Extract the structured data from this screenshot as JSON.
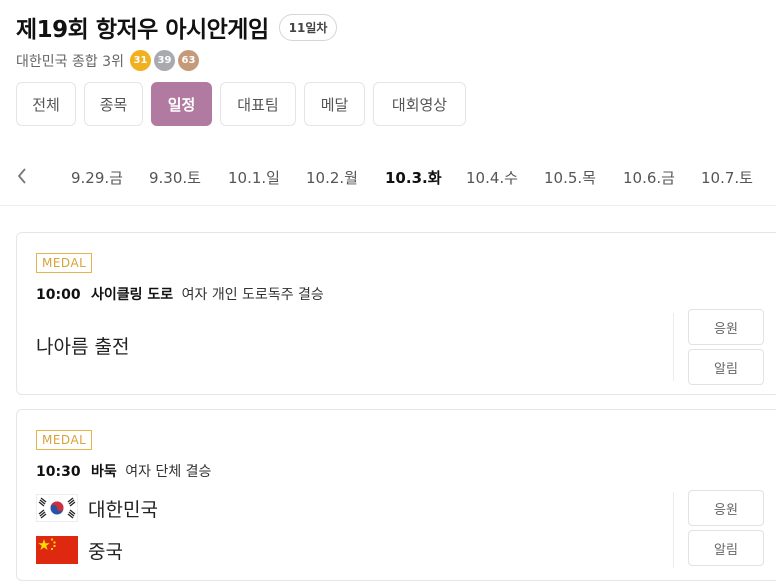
{
  "header": {
    "title": "제19회 항저우 아시안게임",
    "day_badge": "11일차",
    "rank_text": "대한민국 종합 3위",
    "medals": {
      "gold": "31",
      "silver": "39",
      "bronze": "63"
    }
  },
  "tabs": [
    {
      "label": "전체"
    },
    {
      "label": "종목"
    },
    {
      "label": "일정"
    },
    {
      "label": "대표팀"
    },
    {
      "label": "메달"
    },
    {
      "label": "대회영상"
    }
  ],
  "active_tab": "일정",
  "dates": [
    {
      "label": "9.29.금"
    },
    {
      "label": "9.30.토"
    },
    {
      "label": "10.1.일"
    },
    {
      "label": "10.2.월"
    },
    {
      "label": "10.3.화"
    },
    {
      "label": "10.4.수"
    },
    {
      "label": "10.5.목"
    },
    {
      "label": "10.6.금"
    },
    {
      "label": "10.7.토"
    }
  ],
  "active_date": "10.3.화",
  "events": [
    {
      "tag": "MEDAL",
      "time": "10:00",
      "sport": "사이클링 도로",
      "detail": "여자 개인 도로독주 결승",
      "player": "나아름 출전",
      "cheer_label": "응원",
      "alert_label": "알림"
    },
    {
      "tag": "MEDAL",
      "time": "10:30",
      "sport": "바둑",
      "detail": "여자 단체 결승",
      "teams": [
        {
          "name": "대한민국",
          "flag": "korea-flag-icon"
        },
        {
          "name": "중국",
          "flag": "china-flag-icon"
        }
      ],
      "cheer_label": "응원",
      "alert_label": "알림"
    }
  ],
  "colors": {
    "accent": "#b07aa1",
    "medal_tag": "#d9a23a",
    "gold": "#f0b020",
    "silver": "#a9aab0",
    "bronze": "#c49a7a"
  }
}
